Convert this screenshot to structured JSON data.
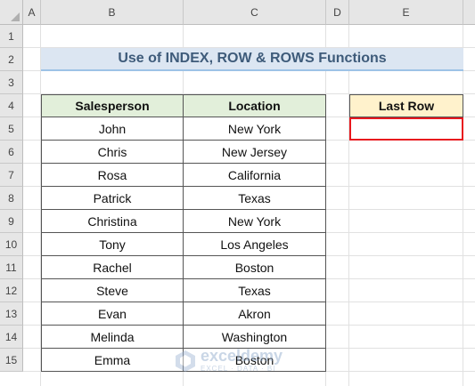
{
  "columns": [
    "A",
    "B",
    "C",
    "D",
    "E"
  ],
  "rows": [
    "1",
    "2",
    "3",
    "4",
    "5",
    "6",
    "7",
    "8",
    "9",
    "10",
    "11",
    "12",
    "13",
    "14",
    "15"
  ],
  "title": "Use of INDEX, ROW & ROWS Functions",
  "table": {
    "headers": [
      "Salesperson",
      "Location"
    ],
    "rows": [
      {
        "salesperson": "John",
        "location": "New York"
      },
      {
        "salesperson": "Chris",
        "location": "New Jersey"
      },
      {
        "salesperson": "Rosa",
        "location": "California"
      },
      {
        "salesperson": "Patrick",
        "location": "Texas"
      },
      {
        "salesperson": "Christina",
        "location": "New York"
      },
      {
        "salesperson": "Tony",
        "location": "Los Angeles"
      },
      {
        "salesperson": "Rachel",
        "location": "Boston"
      },
      {
        "salesperson": "Steve",
        "location": "Texas"
      },
      {
        "salesperson": "Evan",
        "location": "Akron"
      },
      {
        "salesperson": "Melinda",
        "location": "Washington"
      },
      {
        "salesperson": "Emma",
        "location": "Boston"
      }
    ]
  },
  "last_row": {
    "header": "Last Row",
    "value": ""
  },
  "watermark": {
    "name": "exceldemy",
    "tagline": "EXCEL · DATA · BI"
  },
  "colors": {
    "title_bg": "#dce6f2",
    "table_header_bg": "#e2efda",
    "last_row_header_bg": "#fff2cc",
    "selection_border": "#e8181e"
  }
}
